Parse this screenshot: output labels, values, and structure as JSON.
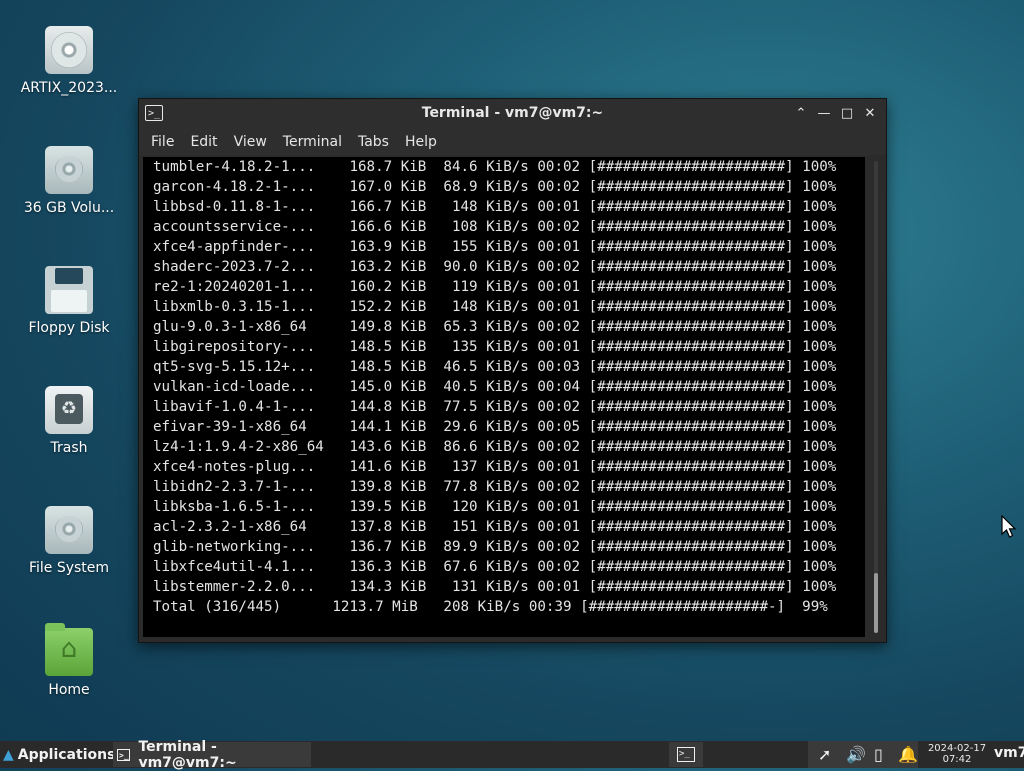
{
  "desktop": {
    "icons": [
      {
        "label": "ARTIX_2023...",
        "icon": "disc-icon"
      },
      {
        "label": "36 GB Volu...",
        "icon": "hard-drive-icon"
      },
      {
        "label": "Floppy Disk",
        "icon": "floppy-icon"
      },
      {
        "label": "Trash",
        "icon": "trash-icon"
      },
      {
        "label": "File System",
        "icon": "hard-drive-icon"
      },
      {
        "label": "Home",
        "icon": "home-folder-icon"
      }
    ]
  },
  "window": {
    "title": "Terminal - vm7@vm7:~",
    "menu": [
      "File",
      "Edit",
      "View",
      "Terminal",
      "Tabs",
      "Help"
    ],
    "lines": [
      "tumbler-4.18.2-1...    168.7 KiB  84.6 KiB/s 00:02 [######################] 100%",
      "garcon-4.18.2-1-...    167.0 KiB  68.9 KiB/s 00:02 [######################] 100%",
      "libbsd-0.11.8-1-...    166.7 KiB   148 KiB/s 00:01 [######################] 100%",
      "accountsservice-...    166.6 KiB   108 KiB/s 00:02 [######################] 100%",
      "xfce4-appfinder-...    163.9 KiB   155 KiB/s 00:01 [######################] 100%",
      "shaderc-2023.7-2...    163.2 KiB  90.0 KiB/s 00:02 [######################] 100%",
      "re2-1:20240201-1...    160.2 KiB   119 KiB/s 00:01 [######################] 100%",
      "libxmlb-0.3.15-1...    152.2 KiB   148 KiB/s 00:01 [######################] 100%",
      "glu-9.0.3-1-x86_64     149.8 KiB  65.3 KiB/s 00:02 [######################] 100%",
      "libgirepository-...    148.5 KiB   135 KiB/s 00:01 [######################] 100%",
      "qt5-svg-5.15.12+...    148.5 KiB  46.5 KiB/s 00:03 [######################] 100%",
      "vulkan-icd-loade...    145.0 KiB  40.5 KiB/s 00:04 [######################] 100%",
      "libavif-1.0.4-1-...    144.8 KiB  77.5 KiB/s 00:02 [######################] 100%",
      "efivar-39-1-x86_64     144.1 KiB  29.6 KiB/s 00:05 [######################] 100%",
      "lz4-1:1.9.4-2-x86_64   143.6 KiB  86.6 KiB/s 00:02 [######################] 100%",
      "xfce4-notes-plug...    141.6 KiB   137 KiB/s 00:01 [######################] 100%",
      "libidn2-2.3.7-1-...    139.8 KiB  77.8 KiB/s 00:02 [######################] 100%",
      "libksba-1.6.5-1-...    139.5 KiB   120 KiB/s 00:01 [######################] 100%",
      "acl-2.3.2-1-x86_64     137.8 KiB   151 KiB/s 00:01 [######################] 100%",
      "glib-networking-...    136.7 KiB  89.9 KiB/s 00:02 [######################] 100%",
      "libxfce4util-4.1...    136.3 KiB  67.6 KiB/s 00:02 [######################] 100%",
      "libstemmer-2.2.0...    134.3 KiB   131 KiB/s 00:01 [######################] 100%",
      "Total (316/445)      1213.7 MiB   208 KiB/s 00:39 [#####################-]  99%"
    ]
  },
  "taskbar": {
    "applications_label": "Applications",
    "task_label": "Terminal - vm7@vm7:~",
    "date": "2024-02-17",
    "time": "07:42",
    "user": "vm7"
  }
}
